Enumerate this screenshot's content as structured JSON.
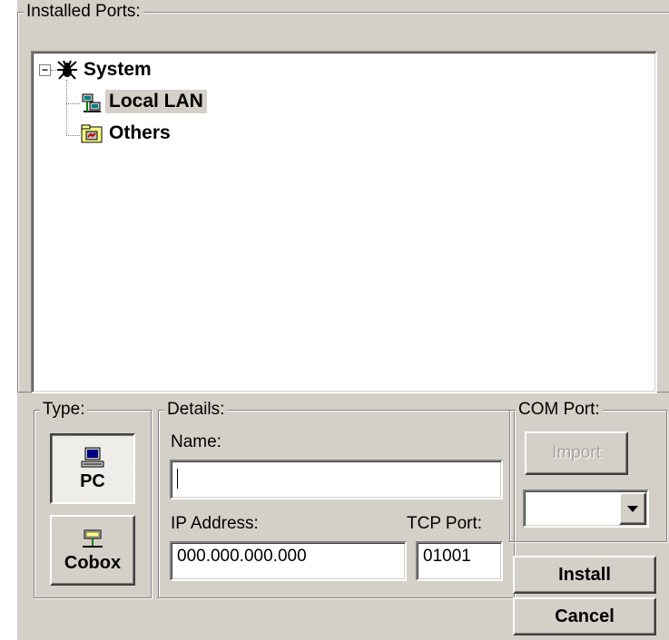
{
  "installed_ports": {
    "title": "Installed Ports:",
    "tree": {
      "root": {
        "label": "System",
        "icon": "spider-icon",
        "expanded": true
      },
      "children": [
        {
          "label": "Local LAN",
          "icon": "network-computers-icon",
          "selected": true
        },
        {
          "label": "Others",
          "icon": "folder-icon",
          "selected": false
        }
      ],
      "expander_symbol": "−"
    }
  },
  "type_group": {
    "title": "Type:",
    "pc_label": "PC",
    "cobox_label": "Cobox",
    "selected": "PC"
  },
  "details": {
    "title": "Details:",
    "name_label": "Name:",
    "name_value": "",
    "ip_label": "IP Address:",
    "ip_value": "000.000.000.000",
    "tcp_label": "TCP Port:",
    "tcp_value": "01001"
  },
  "com_port": {
    "title": "COM Port:",
    "import_label": "Import",
    "import_enabled": false,
    "selected_value": ""
  },
  "actions": {
    "install_label": "Install",
    "cancel_label": "Cancel"
  },
  "colors": {
    "face": "#d4d0c8",
    "shadow": "#808080",
    "highlight": "#ffffff",
    "selection": "#d4d0c8"
  }
}
